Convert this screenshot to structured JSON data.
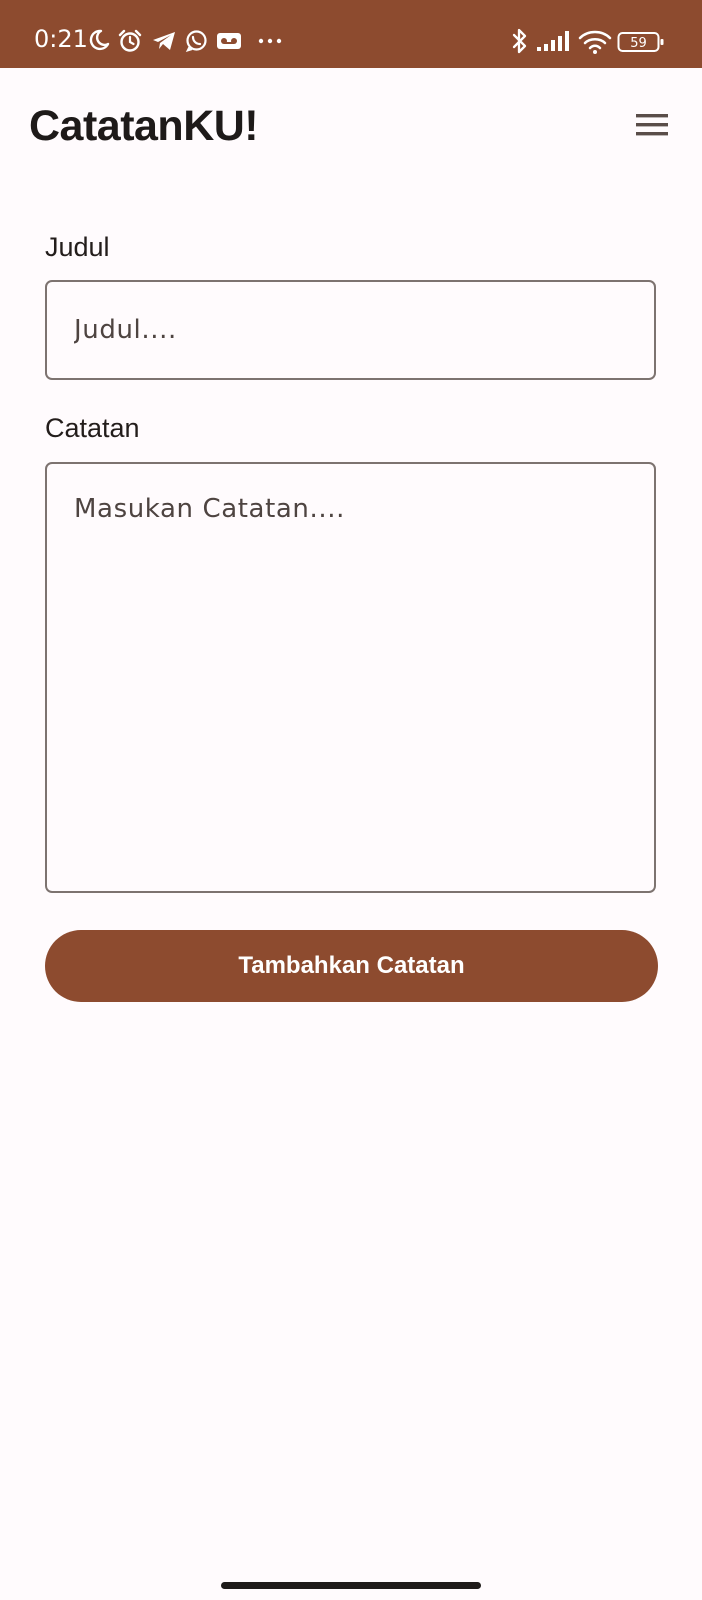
{
  "status_bar": {
    "time": "0:21",
    "battery_level": "59",
    "left_icons": [
      "moon-icon",
      "alarm-icon",
      "telegram-icon",
      "whatsapp-icon",
      "voicemail-icon",
      "more-dots-icon"
    ],
    "right_icons": [
      "bluetooth-icon",
      "signal-icon",
      "wifi-icon",
      "battery-icon"
    ],
    "background_color": "#8d4b2f"
  },
  "app_bar": {
    "title": "CatatanKU!",
    "menu_icon": "hamburger-menu-icon"
  },
  "form": {
    "title_label": "Judul",
    "title_placeholder": "Judul....",
    "title_value": "",
    "note_label": "Catatan",
    "note_placeholder": "Masukan Catatan....",
    "note_value": "",
    "submit_label": "Tambahkan Catatan"
  },
  "colors": {
    "accent": "#8d4b2f",
    "background": "#fffbfd",
    "text": "#1e1a19",
    "outline": "#7d7370"
  }
}
